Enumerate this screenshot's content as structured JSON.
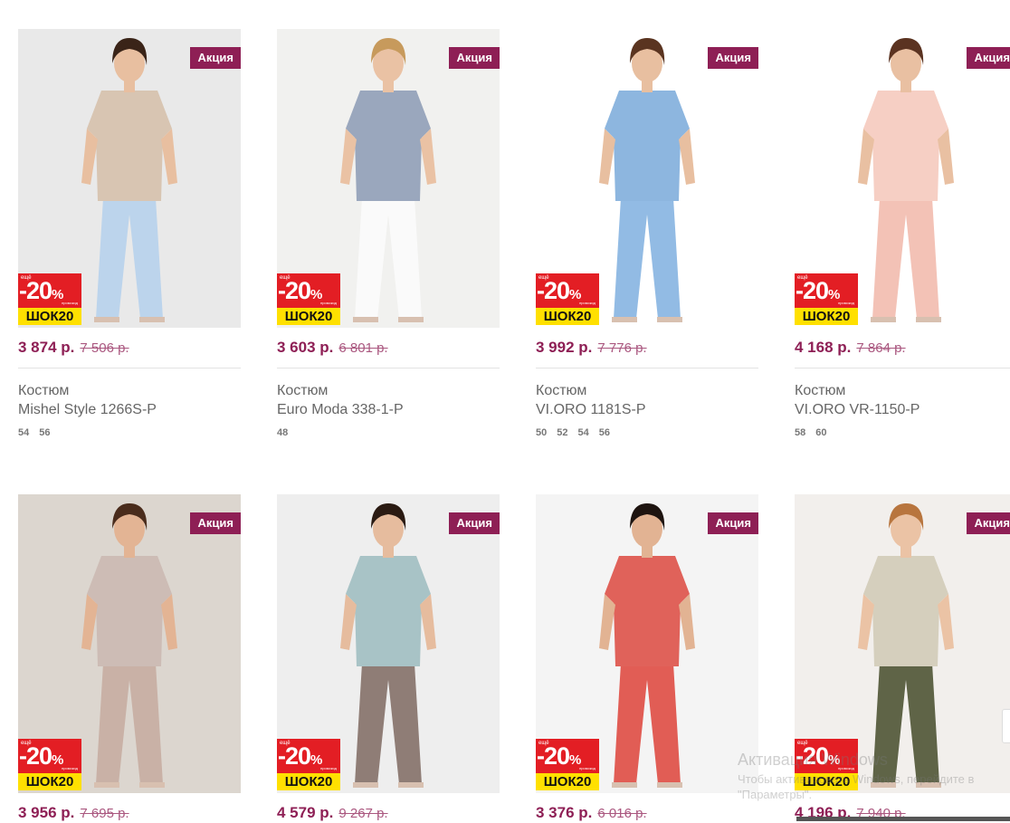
{
  "products": [
    {
      "badge": "Акция",
      "promo": {
        "more": "ещё",
        "percent": "-20",
        "percent_sign": "%",
        "code_label": "промокод",
        "code": "ШОК20"
      },
      "price": "3 874 р.",
      "old_price": "7 506 р.",
      "type": "Костюм",
      "name": "Mishel Style 1266S-P",
      "sizes": [
        "54",
        "56"
      ],
      "colors": {
        "bg": "#e9e9e9",
        "top": "#d8c5b2",
        "bottom": "#bcd4ec",
        "skin": "#e8bfa0",
        "hair": "#3a2418"
      }
    },
    {
      "badge": "Акция",
      "promo": {
        "more": "ещё",
        "percent": "-20",
        "percent_sign": "%",
        "code_label": "промокод",
        "code": "ШОК20"
      },
      "price": "3 603 р.",
      "old_price": "6 801 р.",
      "type": "Костюм",
      "name": "Euro Moda 338-1-P",
      "sizes": [
        "48"
      ],
      "colors": {
        "bg": "#f1f1ef",
        "top": "#9aa7bd",
        "bottom": "#fafafa",
        "skin": "#eac2a4",
        "hair": "#c79a5c"
      }
    },
    {
      "badge": "Акция",
      "promo": {
        "more": "ещё",
        "percent": "-20",
        "percent_sign": "%",
        "code_label": "промокод",
        "code": "ШОК20"
      },
      "price": "3 992 р.",
      "old_price": "7 776 р.",
      "type": "Костюм",
      "name": "VI.ORO 1181S-P",
      "sizes": [
        "50",
        "52",
        "54",
        "56"
      ],
      "colors": {
        "bg": "#ffffff",
        "top": "#8db6df",
        "bottom": "#92bbe4",
        "skin": "#e8bfa0",
        "hair": "#5a3420"
      }
    },
    {
      "badge": "Акция",
      "promo": {
        "more": "ещё",
        "percent": "-20",
        "percent_sign": "%",
        "code_label": "промокод",
        "code": "ШОК20"
      },
      "price": "4 168 р.",
      "old_price": "7 864 р.",
      "type": "Костюм",
      "name": "VI.ORO VR-1150-P",
      "sizes": [
        "58",
        "60"
      ],
      "colors": {
        "bg": "#ffffff",
        "top": "#f6cfc4",
        "bottom": "#f3c2b6",
        "skin": "#e9c0a2",
        "hair": "#5b3321"
      }
    },
    {
      "badge": "Акция",
      "promo": {
        "more": "ещё",
        "percent": "-20",
        "percent_sign": "%",
        "code_label": "промокод",
        "code": "ШОК20"
      },
      "price": "3 956 р.",
      "old_price": "7 695 р.",
      "colors": {
        "bg": "#dcd6cf",
        "top": "#cdbcb5",
        "bottom": "#c9b1a6",
        "skin": "#e3b494",
        "hair": "#4a2c1c"
      }
    },
    {
      "badge": "Акция",
      "promo": {
        "more": "ещё",
        "percent": "-20",
        "percent_sign": "%",
        "code_label": "промокод",
        "code": "ШОК20"
      },
      "price": "4 579 р.",
      "old_price": "9 267 р.",
      "colors": {
        "bg": "#eeeeee",
        "top": "#a8c3c6",
        "bottom": "#8f7d76",
        "skin": "#e6bc9e",
        "hair": "#2a1a12"
      }
    },
    {
      "badge": "Акция",
      "promo": {
        "more": "ещё",
        "percent": "-20",
        "percent_sign": "%",
        "code_label": "промокод",
        "code": "ШОК20"
      },
      "price": "3 376 р.",
      "old_price": "6 016 р.",
      "colors": {
        "bg": "#f4f4f4",
        "top": "#e0625a",
        "bottom": "#e15d55",
        "skin": "#e2b393",
        "hair": "#1e1410"
      }
    },
    {
      "badge": "Акция",
      "promo": {
        "more": "ещё",
        "percent": "-20",
        "percent_sign": "%",
        "code_label": "промокод",
        "code": "ШОК20"
      },
      "price": "4 196 р.",
      "old_price": "7 940 р.",
      "colors": {
        "bg": "#f2efec",
        "top": "#d5cfbd",
        "bottom": "#5f6447",
        "skin": "#ebc3a5",
        "hair": "#b8753e"
      }
    }
  ],
  "watermark": {
    "line1": "Активация Windows",
    "line2": "Чтобы активировать Windows, перейдите в",
    "line3": "\"Параметры\"."
  }
}
